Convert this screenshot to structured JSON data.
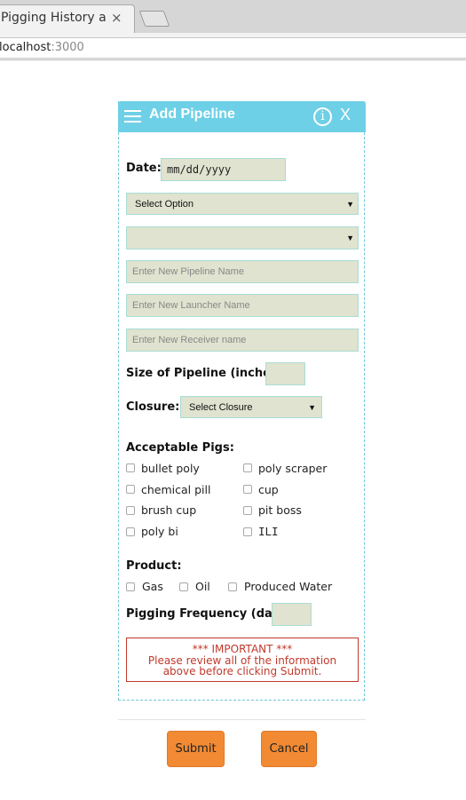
{
  "browser": {
    "tab_title": "Pigging History and Reporting",
    "tab_close": "×",
    "url_host": "localhost",
    "url_port": ":3000"
  },
  "dialog": {
    "title": "Add Pipeline",
    "info_glyph": "i",
    "close_glyph": "X"
  },
  "form": {
    "date_label": "Date:",
    "date_value": "mm/dd/yyyy",
    "select_option": "Select Option",
    "select_second": "",
    "pipeline_placeholder": "Enter New Pipeline Name",
    "launcher_placeholder": "Enter New Launcher Name",
    "receiver_placeholder": "Enter New Receiver name",
    "size_label": "Size of Pipeline (inches):",
    "closure_label": "Closure:",
    "closure_value": "Select Closure",
    "pigs_label": "Acceptable Pigs:",
    "pigs": [
      "bullet poly",
      "poly scraper",
      "chemical pill",
      "cup",
      "brush cup",
      "pit boss",
      "poly bi",
      "ILI"
    ],
    "product_label": "Product:",
    "products": [
      "Gas",
      "Oil",
      "Produced Water"
    ],
    "frequency_label": "Pigging Frequency (days):"
  },
  "notice": {
    "line1": "*** IMPORTANT ***",
    "line2": "Please review all of the information",
    "line3": "above before clicking Submit."
  },
  "buttons": {
    "submit": "Submit",
    "cancel": "Cancel"
  },
  "colors": {
    "header": "#6ed0e6",
    "field_bg": "#dfe3cf",
    "button": "#f28a34",
    "warning": "#c0392b"
  }
}
